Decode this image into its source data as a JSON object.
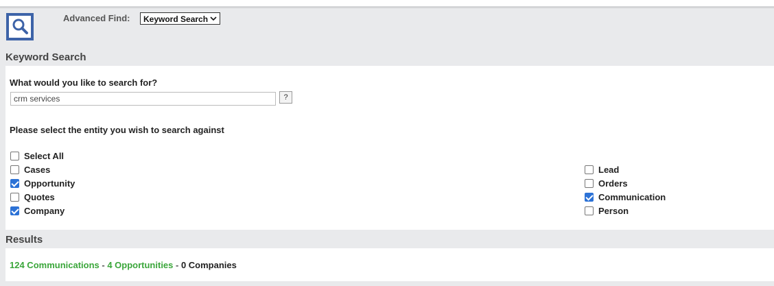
{
  "header": {
    "advanced_find_label": "Advanced Find:",
    "advanced_find_selected": "Keyword Search",
    "icon": "search-icon",
    "accent_color": "#3d63a8"
  },
  "keyword_section": {
    "title": "Keyword Search",
    "question": "What would you like to search for?",
    "search_value": "crm services",
    "help_label": "?",
    "entity_prompt": "Please select the entity you wish to search against"
  },
  "entities_left": [
    {
      "label": "Select All",
      "checked": false
    },
    {
      "label": "Cases",
      "checked": false
    },
    {
      "label": "Opportunity",
      "checked": true
    },
    {
      "label": "Quotes",
      "checked": false
    },
    {
      "label": "Company",
      "checked": true
    }
  ],
  "entities_right": [
    {
      "label": "Lead",
      "checked": false
    },
    {
      "label": "Orders",
      "checked": false
    },
    {
      "label": "Communication",
      "checked": true
    },
    {
      "label": "Person",
      "checked": false
    }
  ],
  "results": {
    "title": "Results",
    "communications": "124 Communications",
    "separator": " - ",
    "opportunities": "4 Opportunities",
    "companies": "0 Companies",
    "link_color": "#3aa63a"
  }
}
